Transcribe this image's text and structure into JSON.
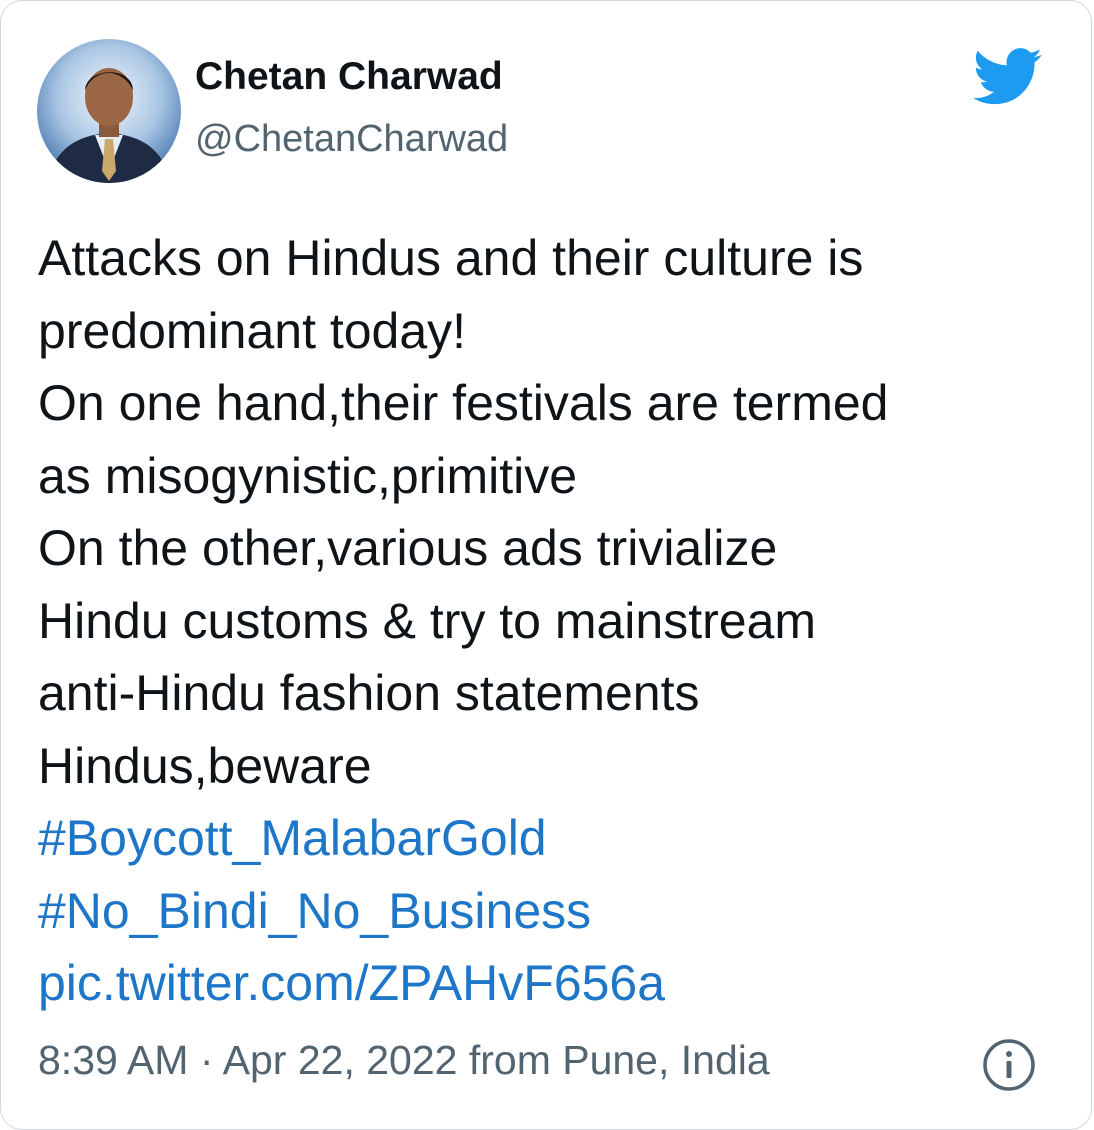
{
  "author": {
    "name": "Chetan Charwad",
    "handle": "@ChetanCharwad",
    "avatar_icon": "profile-photo"
  },
  "brand": {
    "icon": "twitter-bird-icon",
    "color": "#1d9bf0"
  },
  "tweet": {
    "lines": [
      "Attacks on Hindus and their culture is",
      "predominant today!",
      "On one hand,their festivals are termed",
      "as misogynistic,primitive",
      "On the other,various ads trivialize",
      "Hindu customs & try to mainstream",
      "anti-Hindu fashion statements",
      "Hindus,beware"
    ],
    "hashtags": [
      "#Boycott_MalabarGold",
      "#No_Bindi_No_Business"
    ],
    "pic_link": "pic.twitter.com/ZPAHvF656a",
    "link_color": "#1d76c7"
  },
  "meta": {
    "time": "8:39 AM",
    "separator": "·",
    "date": "Apr 22, 2022",
    "location": "from Pune, India",
    "info_icon": "info-icon"
  }
}
